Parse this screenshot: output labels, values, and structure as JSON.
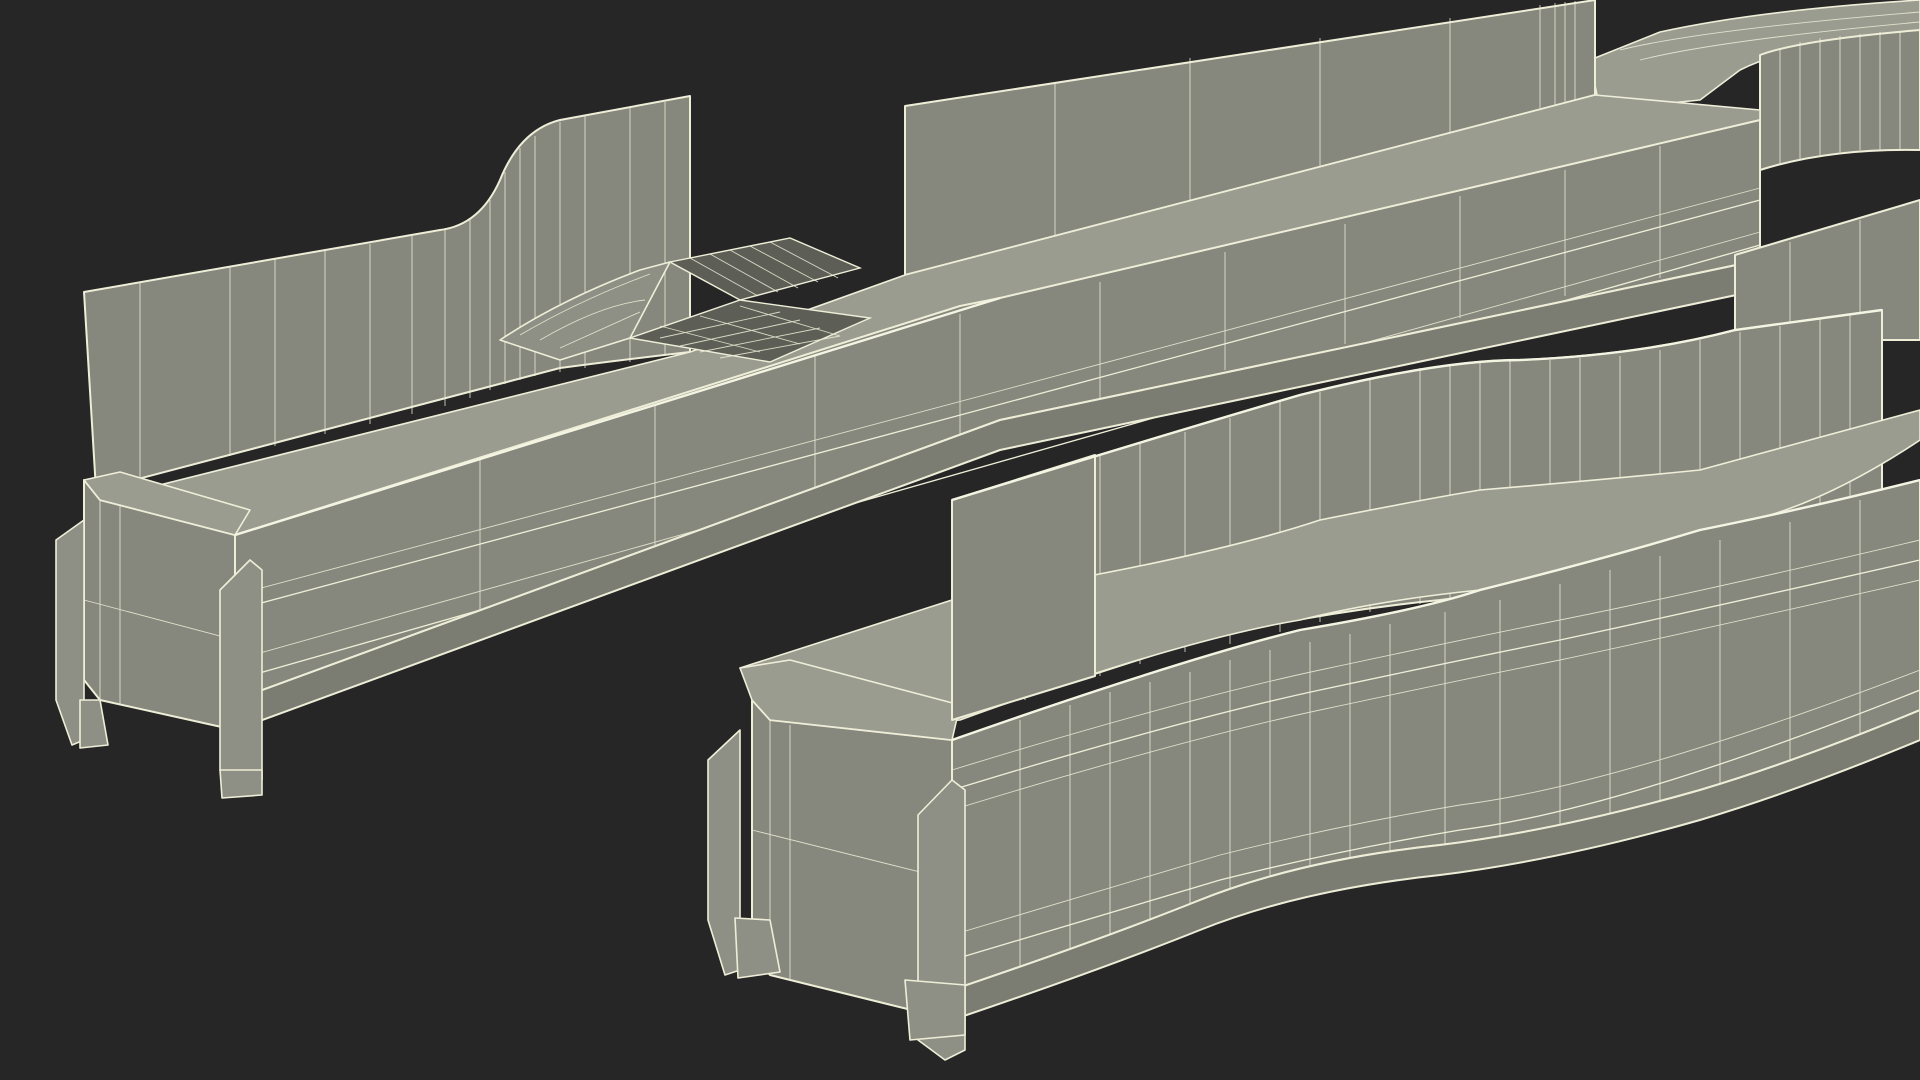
{
  "scene": {
    "subject": "",
    "background_color": "#262626",
    "mesh_fill_color": "#86887d",
    "wire_color": "#eeeed8"
  }
}
